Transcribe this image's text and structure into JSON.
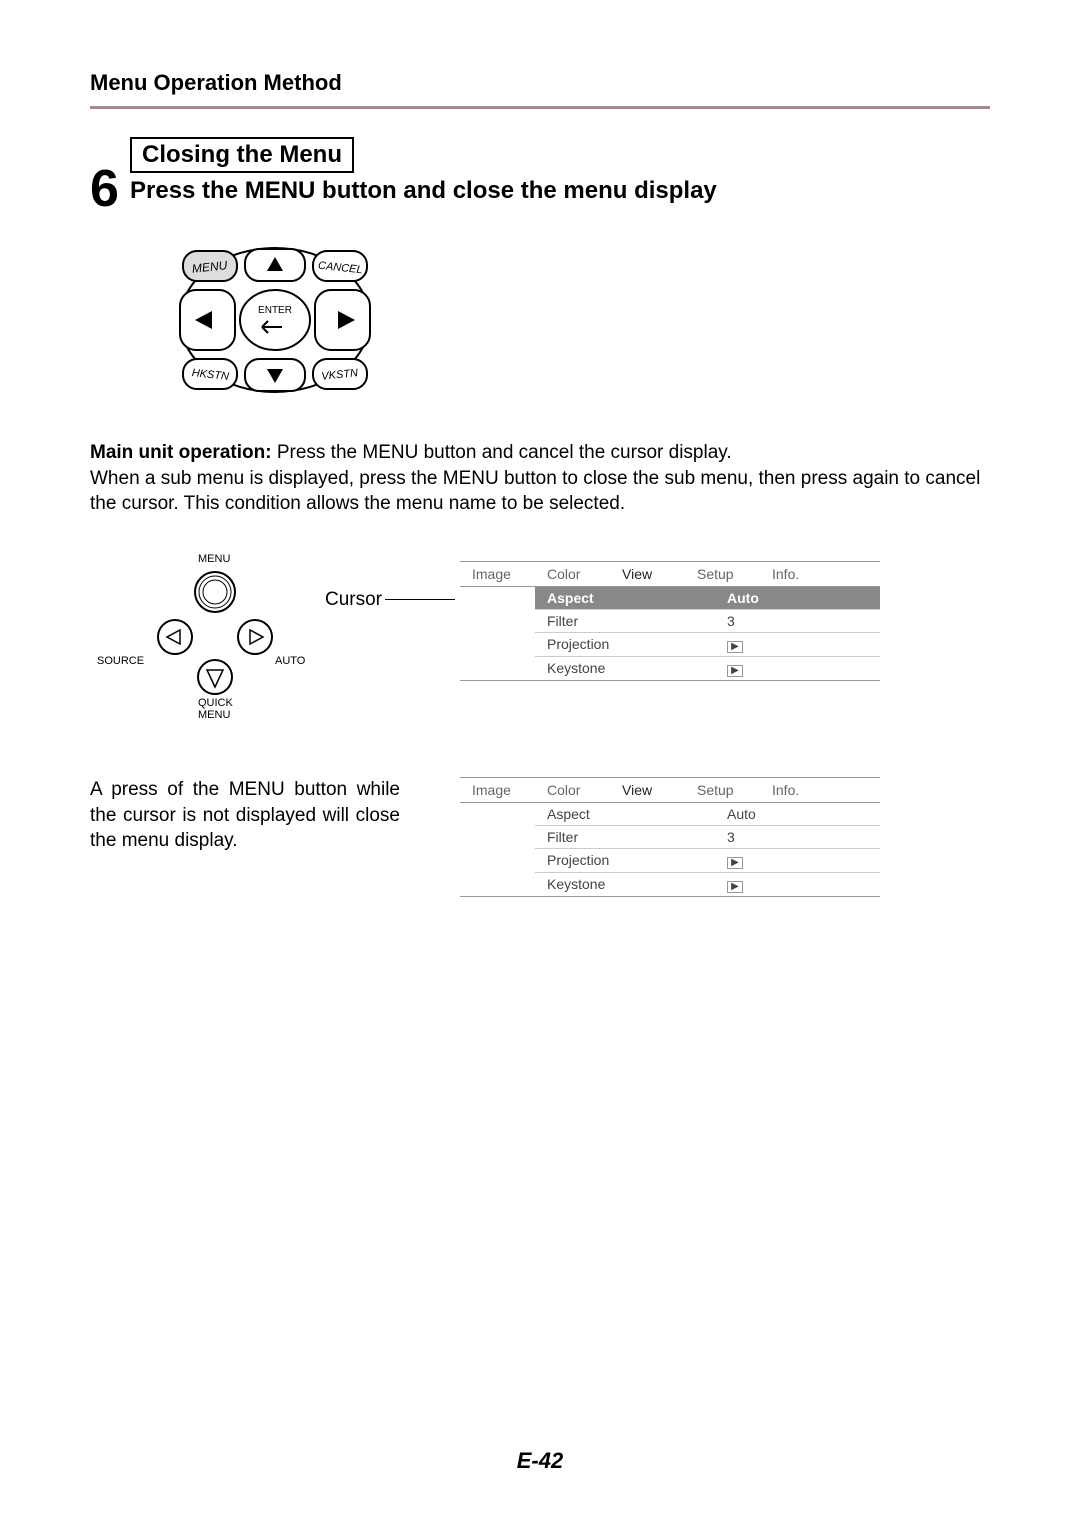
{
  "header": {
    "title": "Menu Operation Method"
  },
  "step": {
    "number": "6",
    "box_title": "Closing the Menu",
    "subtitle": "Press the MENU button and close the menu display"
  },
  "remote": {
    "btn_menu": "MENU",
    "btn_cancel": "CANCEL",
    "btn_enter": "ENTER",
    "btn_hkstn": "HKSTN",
    "btn_vkstn": "VKSTN"
  },
  "main_op": {
    "label": "Main unit operation:",
    "line1": " Press the MENU button and cancel the cursor display.",
    "line2": "When a sub menu is displayed, press the MENU button to close the sub menu, then press again to cancel the cursor. This condition allows the menu name to be selected."
  },
  "pad": {
    "menu": "MENU",
    "source": "SOURCE",
    "auto": "AUTO",
    "quick1": "QUICK",
    "quick2": "MENU"
  },
  "cursor_label": "Cursor",
  "osd_tabs": [
    "Image",
    "Color",
    "View",
    "Setup",
    "Info."
  ],
  "osd1": {
    "rows": [
      {
        "l": "Aspect",
        "r": "Auto",
        "hl": true
      },
      {
        "l": "Filter",
        "r": "3"
      },
      {
        "l": "Projection",
        "r": "▶"
      },
      {
        "l": "Keystone",
        "r": "▶"
      }
    ]
  },
  "osd2": {
    "rows": [
      {
        "l": "Aspect",
        "r": "Auto"
      },
      {
        "l": "Filter",
        "r": "3"
      },
      {
        "l": "Projection",
        "r": "▶"
      },
      {
        "l": "Keystone",
        "r": "▶"
      }
    ]
  },
  "lower_text": "A press of the MENU button while the cursor is not displayed will close the menu display.",
  "page_number": "E-42"
}
